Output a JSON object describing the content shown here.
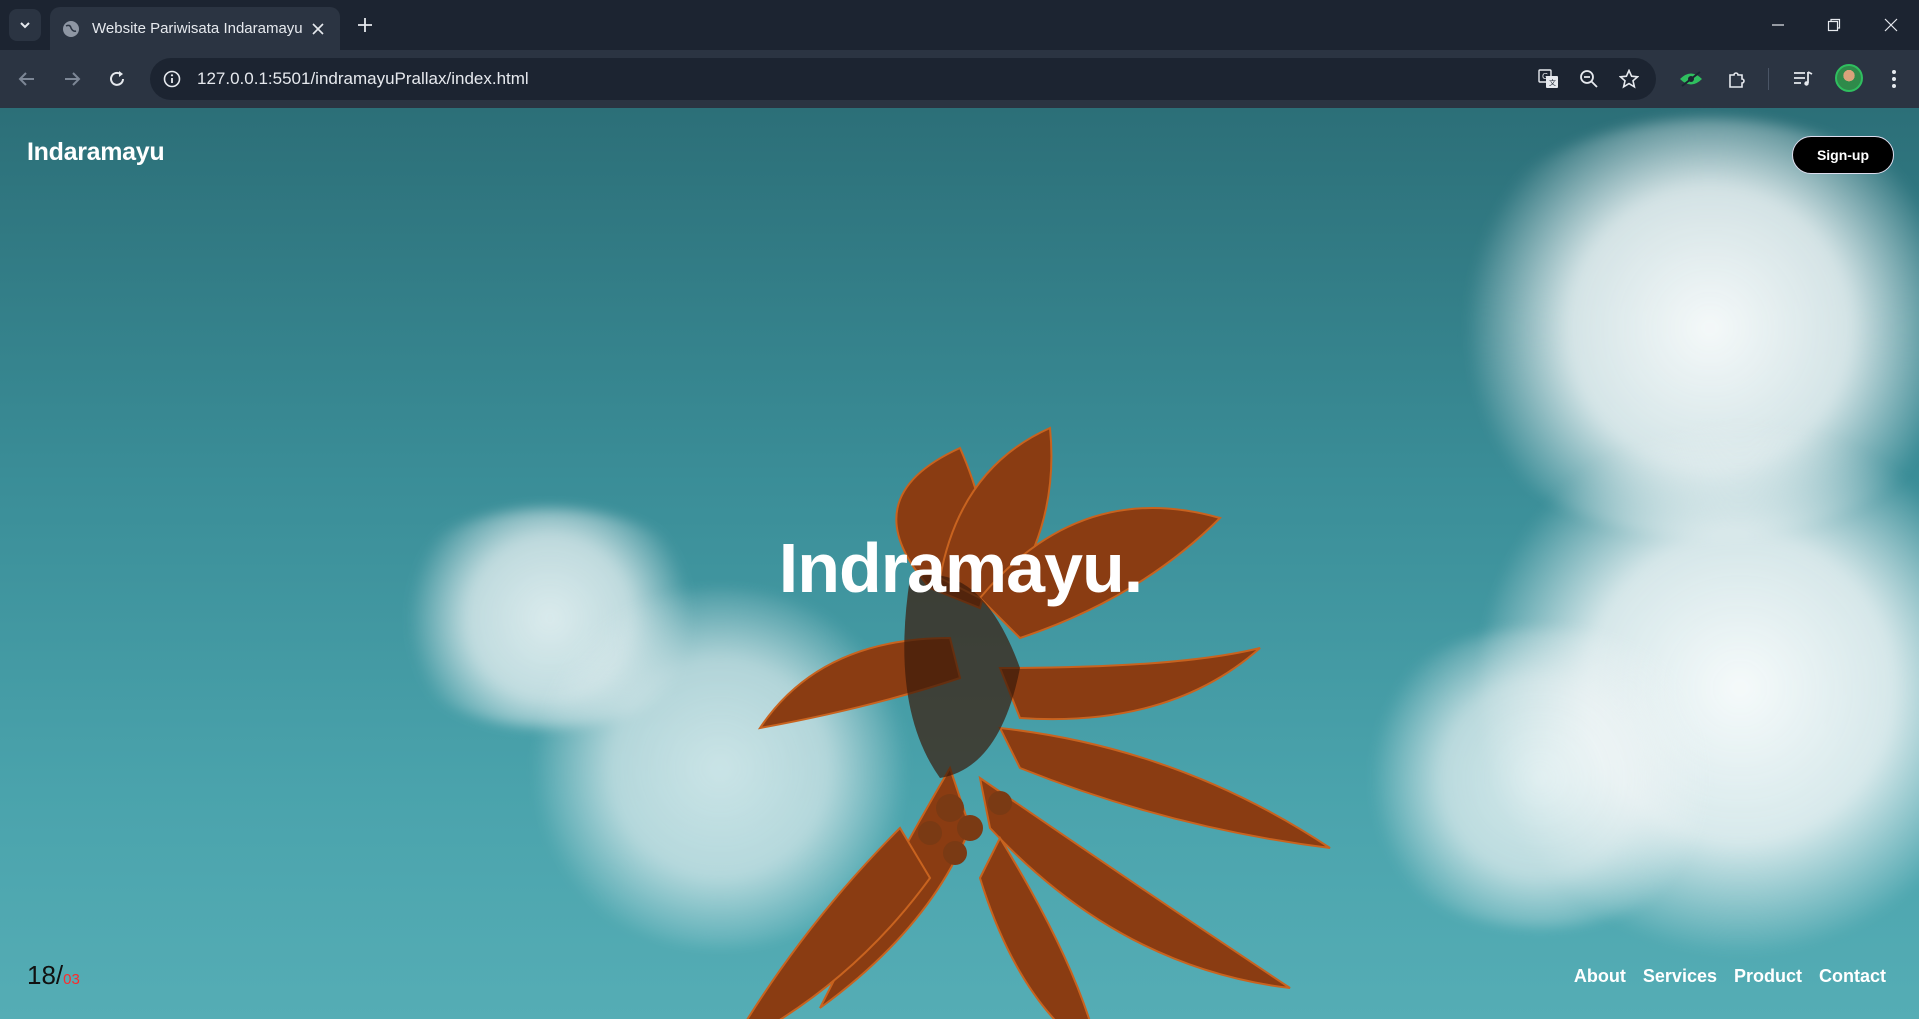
{
  "browser": {
    "tab_title": "Website Pariwisata Indaramayu",
    "url": "127.0.0.1:5501/indramayuPrallax/index.html"
  },
  "page": {
    "logo": "Indaramayu",
    "signup_label": "Sign-up",
    "hero_title": "Indramayu.",
    "counter_current": "18/",
    "counter_total": "03",
    "nav": [
      "About",
      "Services",
      "Product",
      "Contact"
    ]
  },
  "colors": {
    "accent_counter": "#ff2a2a",
    "signup_bg": "#000000",
    "sky": "#3a8d97"
  },
  "icons": [
    "tab-search-icon",
    "globe-icon",
    "close-icon",
    "plus-icon",
    "minimize-icon",
    "restore-icon",
    "window-close-icon",
    "back-icon",
    "forward-icon",
    "reload-icon",
    "info-icon",
    "translate-icon",
    "zoom-out-icon",
    "star-icon",
    "eye-extension-icon",
    "puzzle-icon",
    "media-icon",
    "avatar",
    "kebab-menu-icon"
  ]
}
